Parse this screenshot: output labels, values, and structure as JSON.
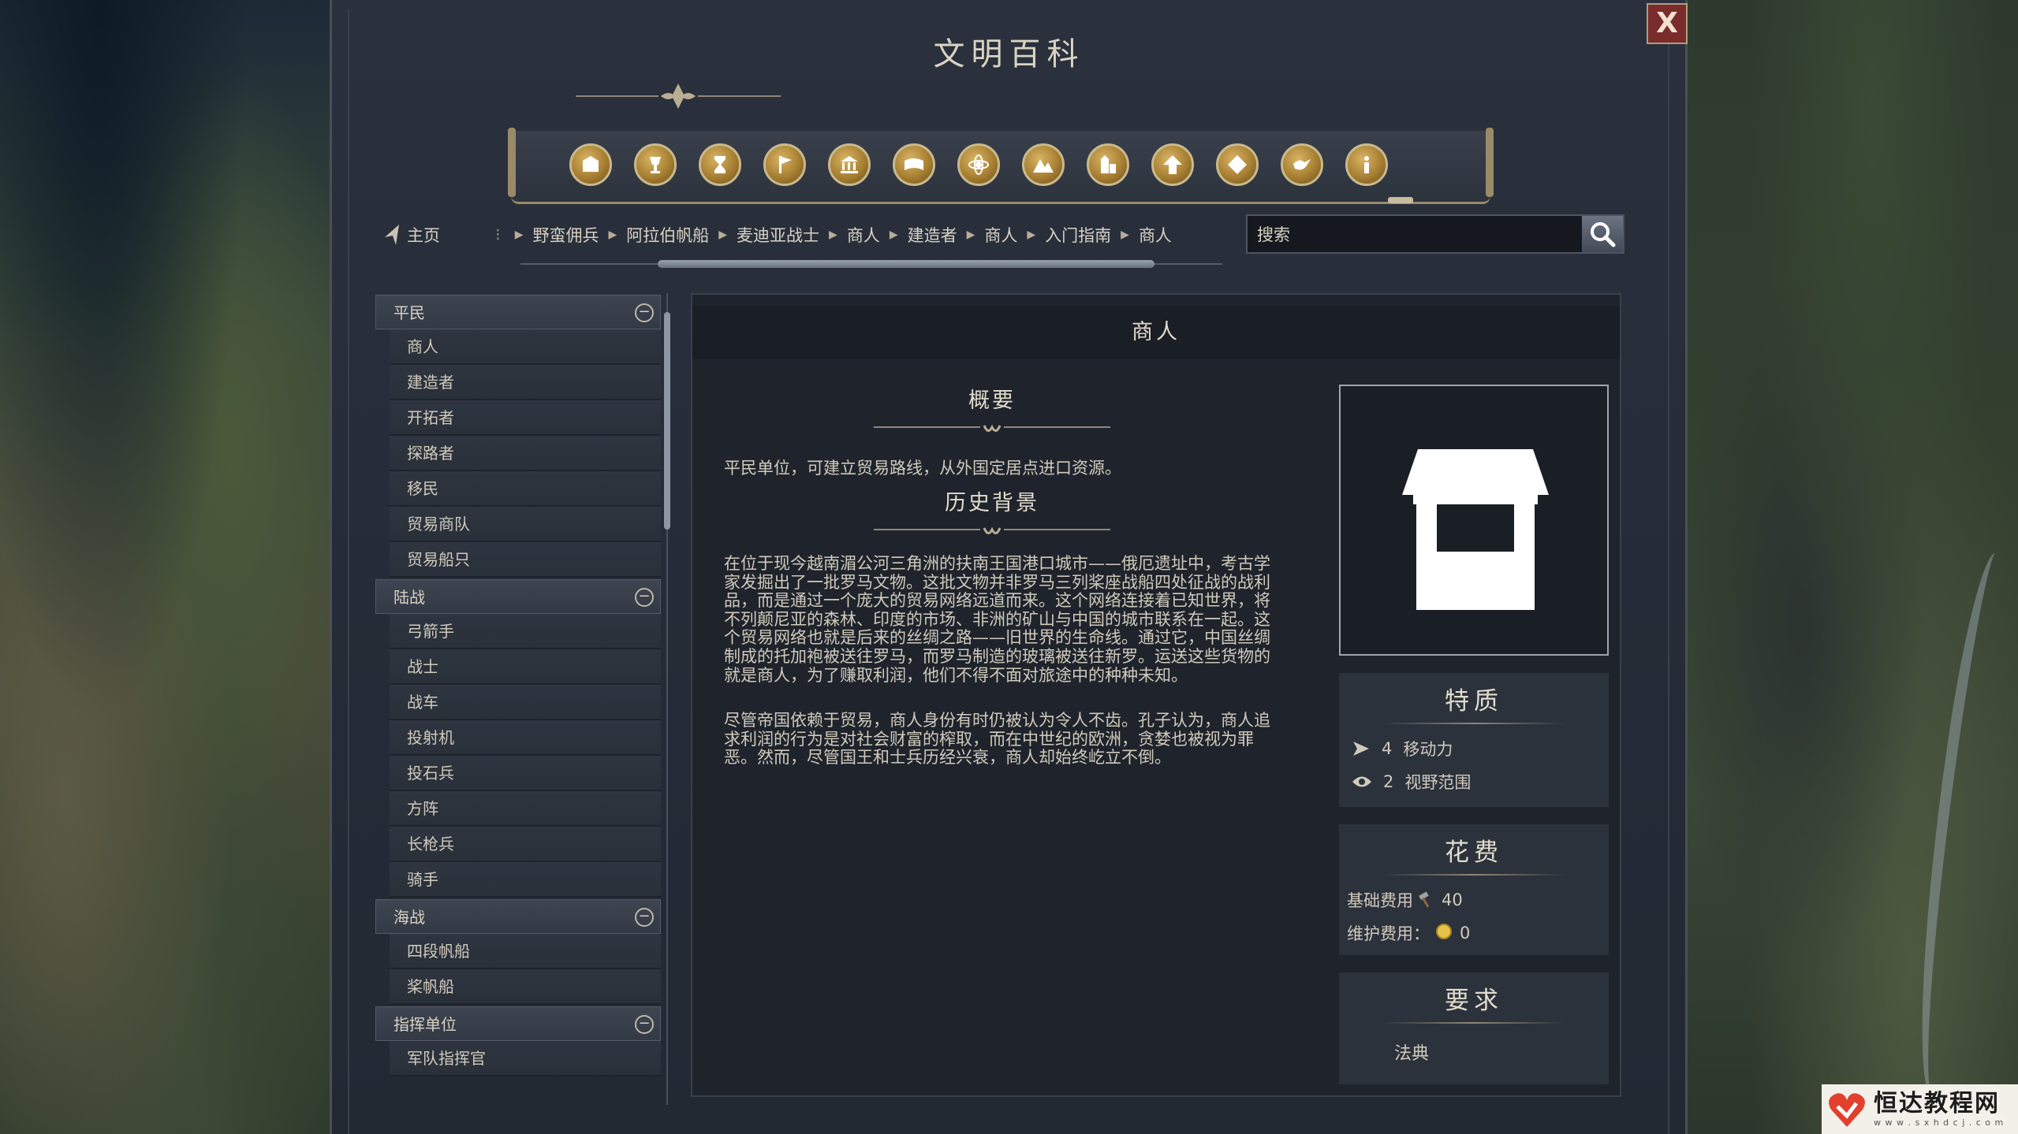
{
  "window": {
    "title": "文明百科",
    "close_label": "X"
  },
  "categories": [
    {
      "icon": "resources-icon"
    },
    {
      "icon": "goblet-icon"
    },
    {
      "icon": "hourglass-icon"
    },
    {
      "icon": "flag-icon"
    },
    {
      "icon": "government-icon"
    },
    {
      "icon": "book-icon"
    },
    {
      "icon": "science-icon"
    },
    {
      "icon": "terrain-icon"
    },
    {
      "icon": "buildings-icon"
    },
    {
      "icon": "upgrade-icon"
    },
    {
      "icon": "wonder-icon"
    },
    {
      "icon": "dove-icon"
    },
    {
      "icon": "info-icon"
    }
  ],
  "nav": {
    "home_label": "主页",
    "breadcrumb_lead": "⁝",
    "breadcrumbs": [
      "野蛮佣兵",
      "阿拉伯帆船",
      "麦迪亚战士",
      "商人",
      "建造者",
      "商人",
      "入门指南",
      "商人"
    ],
    "search_placeholder": "搜索"
  },
  "sidebar": {
    "groups": [
      {
        "label": "平民",
        "items": [
          "商人",
          "建造者",
          "开拓者",
          "探路者",
          "移民",
          "贸易商队",
          "贸易船只"
        ]
      },
      {
        "label": "陆战",
        "items": [
          "弓箭手",
          "战士",
          "战车",
          "投射机",
          "投石兵",
          "方阵",
          "长枪兵",
          "骑手"
        ]
      },
      {
        "label": "海战",
        "items": [
          "四段帆船",
          "桨帆船"
        ]
      },
      {
        "label": "指挥单位",
        "items": [
          "军队指挥官"
        ]
      }
    ],
    "collapse_symbol": "−"
  },
  "article": {
    "title": "商人",
    "summary_heading": "概要",
    "summary_text": "平民单位，可建立贸易路线，从外国定居点进口资源。",
    "history_heading": "历史背景",
    "history_paragraphs": [
      "在位于现今越南湄公河三角洲的扶南王国港口城市——俄厄遗址中，考古学家发掘出了一批罗马文物。这批文物并非罗马三列桨座战船四处征战的战利品，而是通过一个庞大的贸易网络远道而来。这个网络连接着已知世界，将不列颠尼亚的森林、印度的市场、非洲的矿山与中国的城市联系在一起。这个贸易网络也就是后来的丝绸之路——旧世界的生命线。通过它，中国丝绸制成的托加袍被送往罗马，而罗马制造的玻璃被送往新罗。运送这些货物的就是商人，为了赚取利润，他们不得不面对旅途中的种种未知。",
      "尽管帝国依赖于贸易，商人身份有时仍被认为令人不齿。孔子认为，商人追求利润的行为是对社会财富的榨取，而在中世纪的欧洲，贪婪也被视为罪恶。然而，尽管国王和士兵历经兴衰，商人却始终屹立不倒。"
    ]
  },
  "traits": {
    "title": "特质",
    "rows": [
      {
        "icon": "movement-icon",
        "value": "4",
        "label": "移动力"
      },
      {
        "icon": "eye-icon",
        "value": "2",
        "label": "视野范围"
      }
    ]
  },
  "cost": {
    "title": "花费",
    "rows": [
      {
        "label": "基础费用",
        "icon": "hammer-icon",
        "value": "40"
      },
      {
        "label": "维护费用：",
        "icon": "gold-coin-icon",
        "value": "0"
      }
    ]
  },
  "requirements": {
    "title": "要求",
    "value": "法典"
  },
  "watermark": {
    "main": "恒达教程网",
    "sub": "w w w . s x h d c j . c o m"
  },
  "colors": {
    "accent_gold": "#c9a55a",
    "close_red": "#7a2c2c",
    "panel_bg": "#262c37"
  }
}
